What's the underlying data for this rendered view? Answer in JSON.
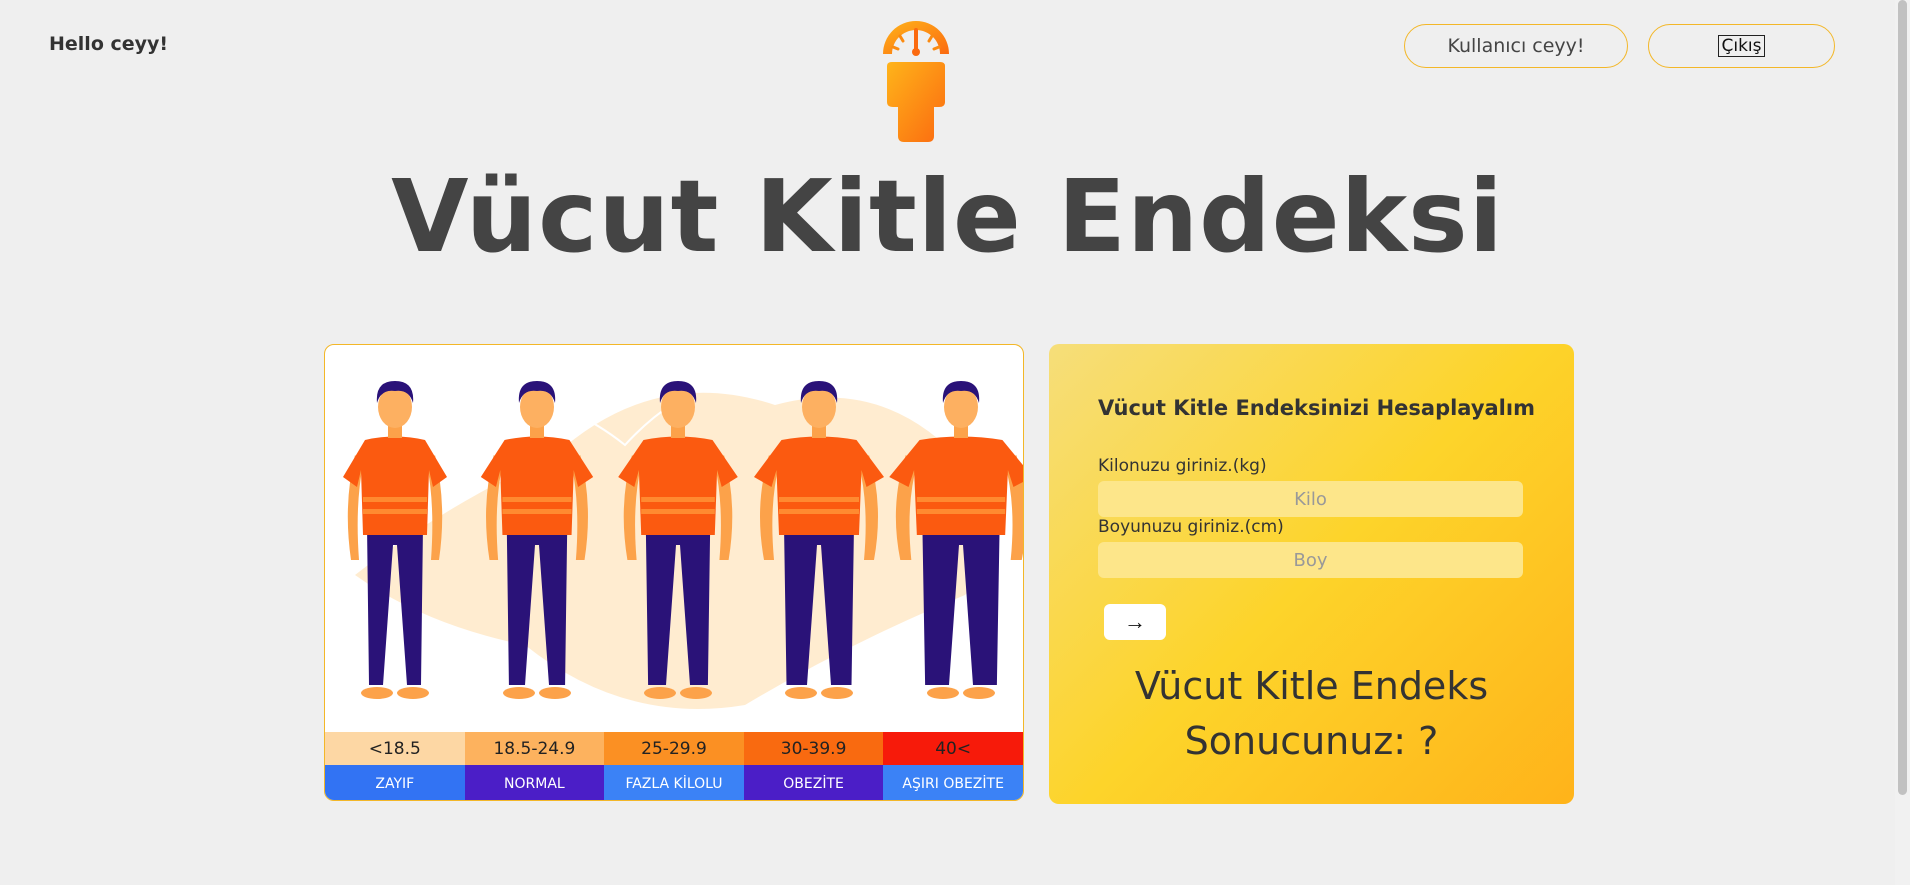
{
  "header": {
    "greeting": "Hello ceyy!",
    "user_button": "Kullanıcı ceyy!",
    "exit_button": "Çıkış"
  },
  "page_title": "Vücut Kitle Endeksi",
  "bmi_chart": {
    "ranges": [
      "<18.5",
      "18.5-24.9",
      "25-29.9",
      "30-39.9",
      "40<"
    ],
    "categories": [
      "ZAYIF",
      "NORMAL",
      "FAZLA KİLOLU",
      "OBEZİTE",
      "AŞIRI OBEZİTE"
    ],
    "range_colors": [
      "#fdd7a4",
      "#fdb25e",
      "#fb9023",
      "#f96a10",
      "#f71a0a"
    ],
    "category_colors": [
      "#3273f3",
      "#4b1ec7",
      "#3b82f6",
      "#4b1ec7",
      "#3b82f6"
    ]
  },
  "form": {
    "heading": "Vücut Kitle Endeksinizi Hesaplayalım",
    "weight_label": "Kilonuzu giriniz.(kg)",
    "weight_placeholder": "Kilo",
    "weight_value": "",
    "height_label": "Boyunuzu giriniz.(cm)",
    "height_placeholder": "Boy",
    "height_value": "",
    "submit_icon": "arrow-right-icon",
    "submit_label": "→",
    "result_line1": "Vücut Kitle Endeks",
    "result_line2": "Sonucunuz: ?"
  },
  "colors": {
    "accent_border": "#f3b728",
    "card_gradient": [
      "#f6de7a",
      "#fdd42a",
      "#ffb31a"
    ],
    "shirt": "#fb5a10",
    "pants": "#2a1278",
    "skin": "#fca24a"
  }
}
